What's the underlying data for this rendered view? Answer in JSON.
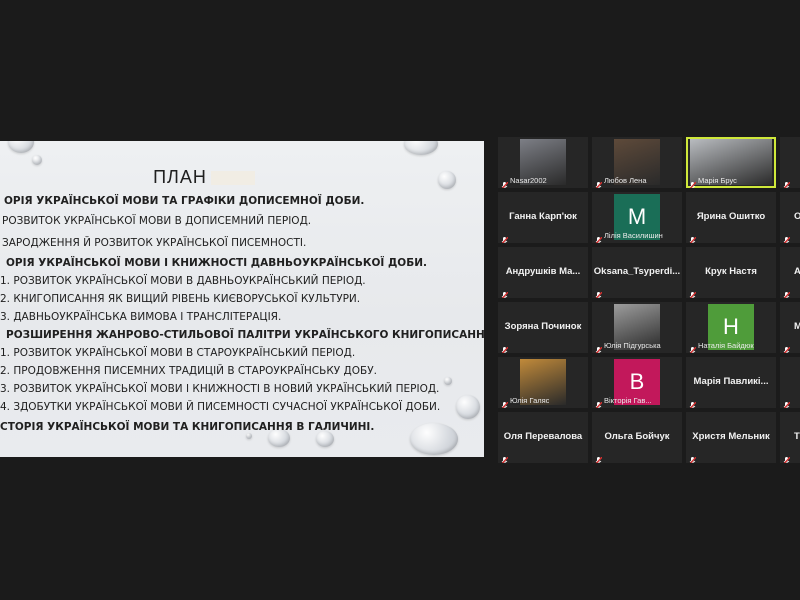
{
  "slide": {
    "title": "ПЛАН",
    "lines": [
      {
        "text": "ОРІЯ УКРАЇНСЬКОЇ МОВИ ТА ГРАФІКИ ДОПИСЕМНОЇ ДОБИ.",
        "bold": true
      },
      {
        "text": "РОЗВИТОК УКРАЇНСЬКОЇ МОВИ В ДОПИСЕМНИЙ ПЕРІОД.",
        "bold": false
      },
      {
        "text": "ЗАРОДЖЕННЯ Й РОЗВИТОК УКРАЇНСЬКОЇ ПИСЕМНОСТІ.",
        "bold": false
      },
      {
        "text": "ОРІЯ УКРАЇНСЬКОЇ МОВИ І КНИЖНОСТІ ДАВНЬОУКРАЇНСЬКОЇ ДОБИ.",
        "bold": true
      },
      {
        "text": "1. РОЗВИТОК УКРАЇНСЬКОЇ МОВИ В ДАВНЬОУКРАЇНСЬКИЙ ПЕРІОД.",
        "bold": false
      },
      {
        "text": "2. КНИГОПИСАННЯ ЯК ВИЩИЙ РІВЕНЬ КИЄВОРУСЬКОЇ КУЛЬТУРИ.",
        "bold": false
      },
      {
        "text": "3. ДАВНЬОУКРАЇНСЬКА ВИМОВА І ТРАНСЛІТЕРАЦІЯ.",
        "bold": false
      },
      {
        "text": "РОЗШИРЕННЯ ЖАНРОВО-СТИЛЬОВОЇ ПАЛІТРИ УКРАЇНСЬКОГО КНИГОПИСАННЯ.",
        "bold": true
      },
      {
        "text": "1. РОЗВИТОК УКРАЇНСЬКОЇ МОВИ В СТАРОУКРАЇНСЬКИЙ ПЕРІОД.",
        "bold": false
      },
      {
        "text": "2. ПРОДОВЖЕННЯ ПИСЕМНИХ ТРАДИЦІЙ В СТАРОУКРАЇНСЬКУ ДОБУ.",
        "bold": false
      },
      {
        "text": "3. РОЗВИТОК УКРАЇНСЬКОЇ МОВИ І КНИЖНОСТІ В НОВИЙ УКРАЇНСЬКИЙ ПЕРІОД.",
        "bold": false
      },
      {
        "text": "4. ЗДОБУТКИ УКРАЇНСЬКОЇ МОВИ Й ПИСЕМНОСТІ СУЧАСНОЇ УКРАЇНСЬКОЇ ДОБИ.",
        "bold": false
      },
      {
        "text": "СТОРІЯ УКРАЇНСЬКОЇ МОВИ ТА КНИГОПИСАННЯ В ГАЛИЧИНІ.",
        "bold": true
      }
    ]
  },
  "participants": [
    {
      "id": "p1",
      "label": "Nasar2002",
      "type": "video",
      "tone": "#7d7f86"
    },
    {
      "id": "p2",
      "label": "Любов Лена",
      "type": "video",
      "tone": "#5e4a3a"
    },
    {
      "id": "p3",
      "label": "Марія Брус",
      "type": "video",
      "tone": "#b9bcc0",
      "active": true
    },
    {
      "id": "p4",
      "name": "Ганна Карп'юк",
      "type": "name"
    },
    {
      "id": "p5",
      "label": "Лілія Василишин",
      "initial": "М",
      "color": "#1a6e57",
      "type": "avatar"
    },
    {
      "id": "p6",
      "name": "Ярина Ошитко",
      "type": "name"
    },
    {
      "id": "p7",
      "name": "Андрушків Ма...",
      "type": "name"
    },
    {
      "id": "p8",
      "name": "Oksana_Tsyperdi...",
      "type": "name"
    },
    {
      "id": "p9",
      "name": "Крук Настя",
      "type": "name"
    },
    {
      "id": "p10",
      "name": "Зоряна Починок",
      "type": "name"
    },
    {
      "id": "p11",
      "label": "Юлія Підгурська",
      "type": "video",
      "tone": "#9d9d9d"
    },
    {
      "id": "p12",
      "label": "Наталія Байдюк",
      "initial": "Н",
      "color": "#4f9c3a",
      "type": "avatar"
    },
    {
      "id": "p13",
      "label": "Юлія Галяс",
      "type": "video",
      "tone": "#c18a3a"
    },
    {
      "id": "p14",
      "label": "Вікторія Гав...",
      "initial": "В",
      "color": "#c2185b",
      "type": "avatar"
    },
    {
      "id": "p15",
      "name": "Марія Павликі...",
      "type": "name"
    },
    {
      "id": "p16",
      "name": "Оля Перевалова",
      "type": "name"
    },
    {
      "id": "p17",
      "name": "Ольга Бойчук",
      "type": "name"
    },
    {
      "id": "p18",
      "name": "Христя Мельник",
      "type": "name"
    }
  ],
  "partial_column": [
    {
      "label": "",
      "row": 0
    },
    {
      "label": "О",
      "row": 1
    },
    {
      "label": "А",
      "row": 2
    },
    {
      "label": "М",
      "row": 3
    },
    {
      "label": "",
      "row": 4
    },
    {
      "label": "Т",
      "row": 5
    }
  ],
  "colors": {
    "mic_muted": "#d32f2f",
    "active_border": "#cfe83a"
  }
}
